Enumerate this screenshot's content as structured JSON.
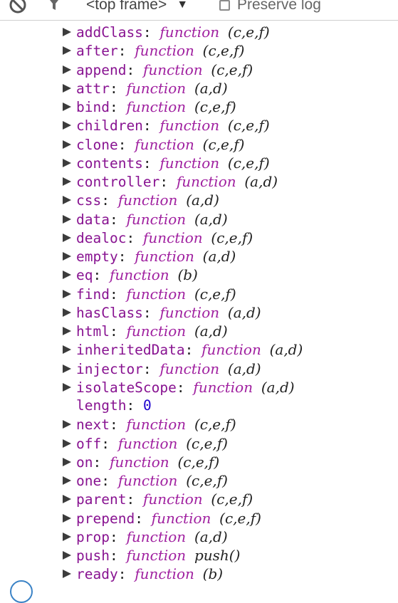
{
  "toolbar": {
    "clear_icon": "clear-console-icon",
    "filter_icon": "filter-icon",
    "frame_selector": "<top frame>",
    "preserve_log_label": "Preserve log",
    "preserve_log_checked": false
  },
  "properties": [
    {
      "key": "addClass",
      "expandable": true,
      "type": "function",
      "args": "(c,e,f)"
    },
    {
      "key": "after",
      "expandable": true,
      "type": "function",
      "args": "(c,e,f)"
    },
    {
      "key": "append",
      "expandable": true,
      "type": "function",
      "args": "(c,e,f)"
    },
    {
      "key": "attr",
      "expandable": true,
      "type": "function",
      "args": "(a,d)"
    },
    {
      "key": "bind",
      "expandable": true,
      "type": "function",
      "args": "(c,e,f)"
    },
    {
      "key": "children",
      "expandable": true,
      "type": "function",
      "args": "(c,e,f)"
    },
    {
      "key": "clone",
      "expandable": true,
      "type": "function",
      "args": "(c,e,f)"
    },
    {
      "key": "contents",
      "expandable": true,
      "type": "function",
      "args": "(c,e,f)"
    },
    {
      "key": "controller",
      "expandable": true,
      "type": "function",
      "args": "(a,d)"
    },
    {
      "key": "css",
      "expandable": true,
      "type": "function",
      "args": "(a,d)"
    },
    {
      "key": "data",
      "expandable": true,
      "type": "function",
      "args": "(a,d)"
    },
    {
      "key": "dealoc",
      "expandable": true,
      "type": "function",
      "args": "(c,e,f)"
    },
    {
      "key": "empty",
      "expandable": true,
      "type": "function",
      "args": "(a,d)"
    },
    {
      "key": "eq",
      "expandable": true,
      "type": "function",
      "args": "(b)"
    },
    {
      "key": "find",
      "expandable": true,
      "type": "function",
      "args": "(c,e,f)"
    },
    {
      "key": "hasClass",
      "expandable": true,
      "type": "function",
      "args": "(a,d)"
    },
    {
      "key": "html",
      "expandable": true,
      "type": "function",
      "args": "(a,d)"
    },
    {
      "key": "inheritedData",
      "expandable": true,
      "type": "function",
      "args": "(a,d)"
    },
    {
      "key": "injector",
      "expandable": true,
      "type": "function",
      "args": "(a,d)"
    },
    {
      "key": "isolateScope",
      "expandable": true,
      "type": "function",
      "args": "(a,d)"
    },
    {
      "key": "length",
      "expandable": false,
      "type": "number",
      "value": "0"
    },
    {
      "key": "next",
      "expandable": true,
      "type": "function",
      "args": "(c,e,f)"
    },
    {
      "key": "off",
      "expandable": true,
      "type": "function",
      "args": "(c,e,f)"
    },
    {
      "key": "on",
      "expandable": true,
      "type": "function",
      "args": "(c,e,f)"
    },
    {
      "key": "one",
      "expandable": true,
      "type": "function",
      "args": "(c,e,f)"
    },
    {
      "key": "parent",
      "expandable": true,
      "type": "function",
      "args": "(c,e,f)"
    },
    {
      "key": "prepend",
      "expandable": true,
      "type": "function",
      "args": "(c,e,f)"
    },
    {
      "key": "prop",
      "expandable": true,
      "type": "function",
      "args": "(a,d)"
    },
    {
      "key": "push",
      "expandable": true,
      "type": "function",
      "args": "push()"
    },
    {
      "key": "ready",
      "expandable": true,
      "type": "function",
      "args": "(b)"
    }
  ],
  "labels": {
    "function_keyword": "function"
  },
  "colors": {
    "key": "#881391",
    "function_keyword": "#a020a0",
    "number": "#1c00cf",
    "triangle": "#3c3c3c"
  }
}
